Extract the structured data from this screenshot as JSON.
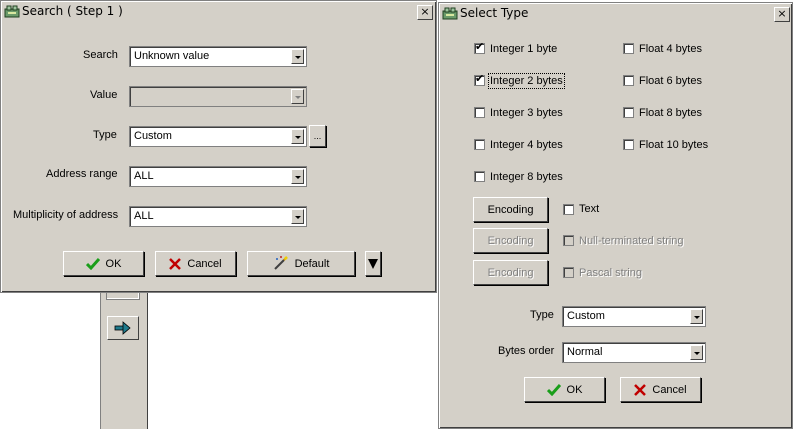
{
  "search_dialog": {
    "title": "Search ( Step 1 )",
    "close_glyph": "×",
    "fields": {
      "search_label": "Search",
      "search_value": "Unknown value",
      "value_label": "Value",
      "value_value": "",
      "type_label": "Type",
      "type_value": "Custom",
      "type_extra_button": "...",
      "address_label": "Address range",
      "address_value": "ALL",
      "multiplicity_label": "Multiplicity of address",
      "multiplicity_value": "ALL"
    },
    "buttons": {
      "ok": "OK",
      "cancel": "Cancel",
      "default": "Default"
    }
  },
  "select_type_dialog": {
    "title": "Select Type",
    "close_glyph": "×",
    "checkboxes": [
      {
        "label": "Integer 1 byte",
        "checked": true
      },
      {
        "label": "Integer 2 bytes",
        "checked": true
      },
      {
        "label": "Integer 3 bytes",
        "checked": false
      },
      {
        "label": "Integer 4 bytes",
        "checked": false
      },
      {
        "label": "Integer 8 bytes",
        "checked": false
      },
      {
        "label": "Float 4 bytes",
        "checked": false
      },
      {
        "label": "Float 6 bytes",
        "checked": false
      },
      {
        "label": "Float 8 bytes",
        "checked": false
      },
      {
        "label": "Float 10 bytes",
        "checked": false
      }
    ],
    "strings": [
      {
        "button": "Encoding",
        "label": "Text",
        "enabled": true
      },
      {
        "button": "Encoding",
        "label": "Null-terminated string",
        "enabled": false
      },
      {
        "button": "Encoding",
        "label": "Pascal string",
        "enabled": false
      }
    ],
    "type_label": "Type",
    "type_value": "Custom",
    "bytes_order_label": "Bytes order",
    "bytes_order_value": "Normal",
    "buttons": {
      "ok": "OK",
      "cancel": "Cancel"
    }
  },
  "colors": {
    "face": "#d4d0c8",
    "shadow": "#808080",
    "dark": "#404040",
    "check_green": "#1a9e1a",
    "cancel_red": "#c00000",
    "arrow_teal": "#1f7a8c"
  }
}
